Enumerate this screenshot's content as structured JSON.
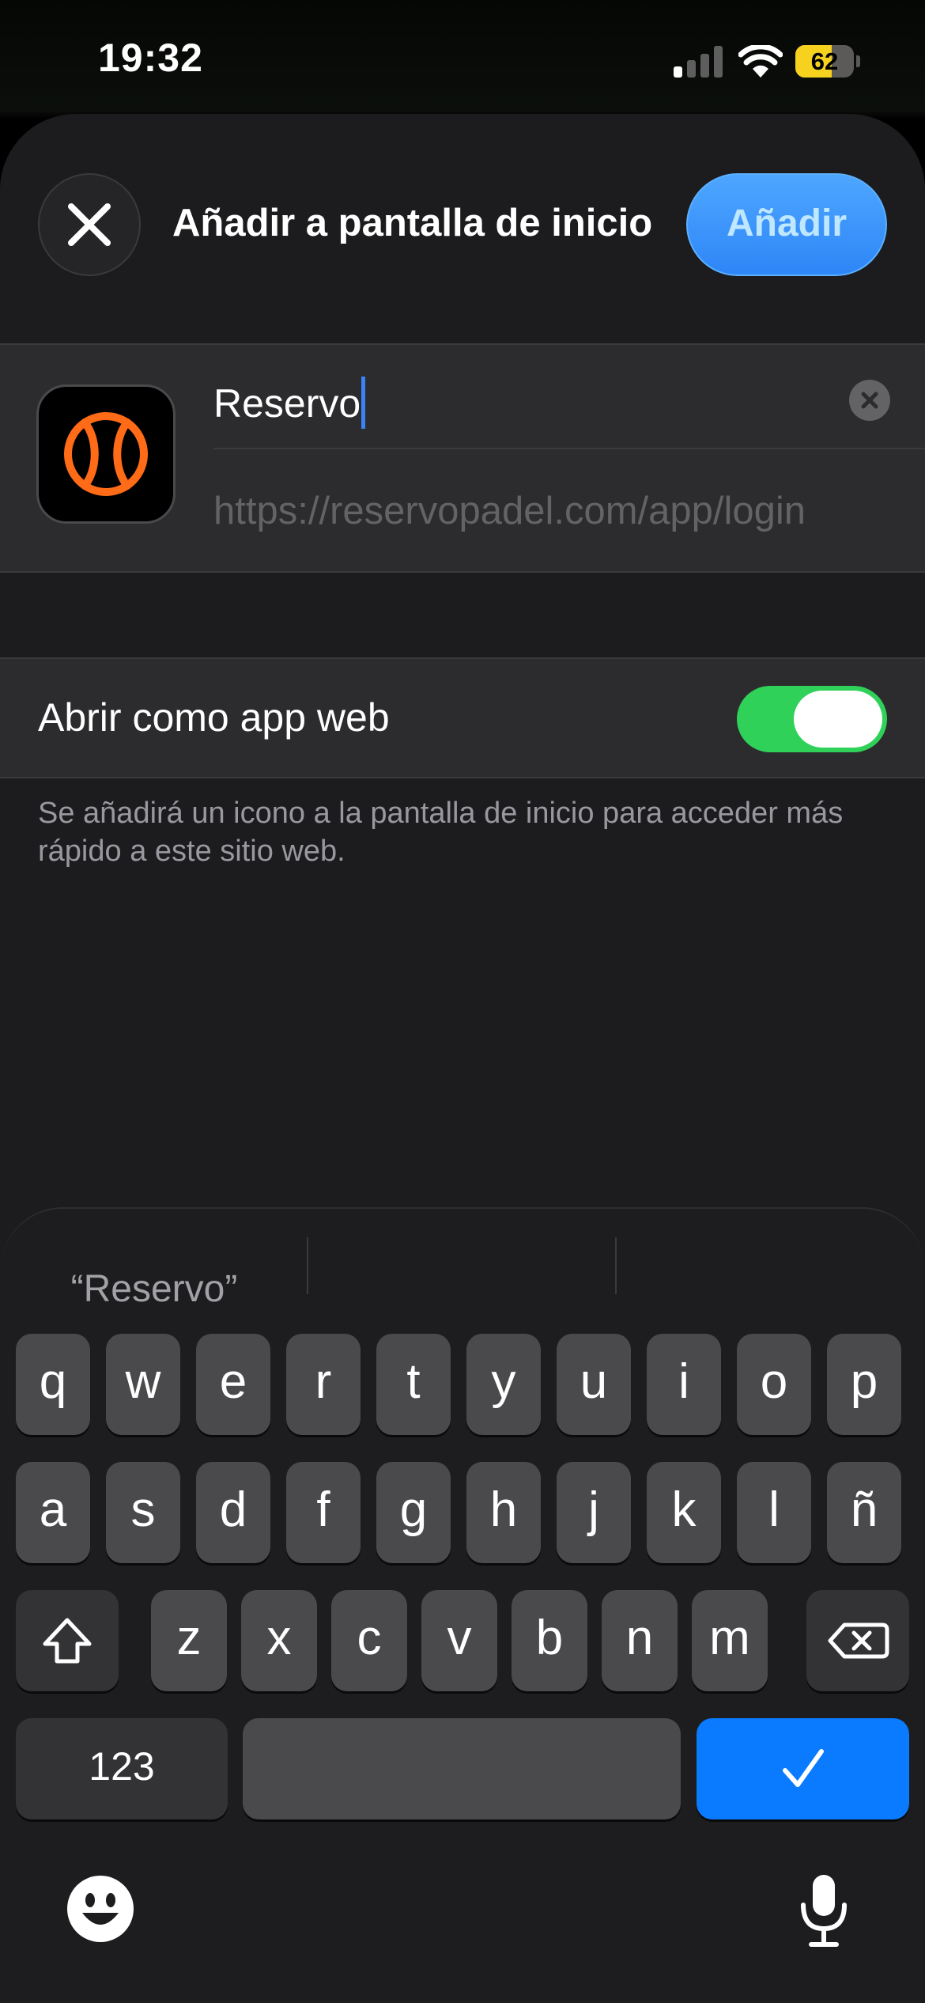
{
  "status_bar": {
    "time": "19:32",
    "battery_level": "62",
    "battery_fraction": 0.62,
    "battery_color": "#f6d11d",
    "icons": [
      "signal-icon",
      "wifi-icon",
      "battery-icon"
    ]
  },
  "sheet": {
    "title": "Añadir a pantalla de inicio",
    "add_label": "Añadir",
    "close_icon": "close-icon"
  },
  "bookmark": {
    "name_value": "Reservo",
    "url": "https://reservopadel.com/app/login",
    "app_icon": "tennis-ball-icon",
    "icon_color": "#ff6b17"
  },
  "web_app": {
    "label": "Abrir como app web",
    "enabled": true,
    "toggle_color": "#30d158"
  },
  "footnote": "Se añadirá un icono a la pantalla de inicio para acceder más rápido a este sitio web.",
  "keyboard": {
    "suggestions": [
      "“Reservo”",
      "",
      ""
    ],
    "row1": [
      "q",
      "w",
      "e",
      "r",
      "t",
      "y",
      "u",
      "i",
      "o",
      "p"
    ],
    "row2": [
      "a",
      "s",
      "d",
      "f",
      "g",
      "h",
      "j",
      "k",
      "l",
      "ñ"
    ],
    "row3": [
      "z",
      "x",
      "c",
      "v",
      "b",
      "n",
      "m"
    ],
    "numbers_label": "123",
    "return_icon": "checkmark-icon",
    "shift_icon": "shift-icon",
    "delete_icon": "backspace-icon",
    "emoji_icon": "emoji-icon",
    "mic_icon": "microphone-icon",
    "return_color": "#0a7aff"
  }
}
